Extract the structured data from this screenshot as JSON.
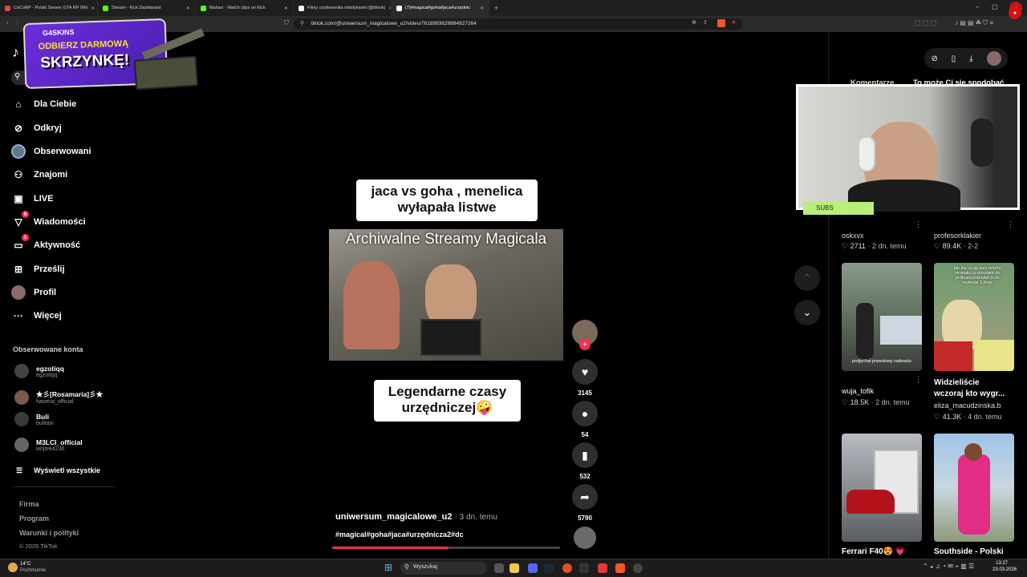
{
  "browser": {
    "tabs": [
      {
        "label": "CoCoRP - Polski Serwer GTA RP Whi",
        "color": "#e5483d"
      },
      {
        "label": "Stream - Kick Dashboard",
        "color": "#53fc18"
      },
      {
        "label": "Maharr - Watch clips on Kick",
        "color": "#53fc18"
      },
      {
        "label": "Filmy użytkownika mlodykamil (@tiktok)",
        "color": "#ffffff"
      },
      {
        "label": "(7)#magical#goha#jaca#urzędnic",
        "color": "#ffffff",
        "active": true
      }
    ],
    "url": "tiktok.com/@uniwersum_magicalowe_u2/video/7618993629884927264"
  },
  "promo": {
    "brand": "G4SKINS",
    "line1": "ODBIERZ DARMOWĄ",
    "line2": "SKRZYNKĘ!"
  },
  "sidebar": {
    "nav": [
      {
        "label": "Dla Ciebie",
        "icon": "home-icon"
      },
      {
        "label": "Odkryj",
        "icon": "compass-icon"
      },
      {
        "label": "Obserwowani",
        "icon": "following-avatar-icon"
      },
      {
        "label": "Znajomi",
        "icon": "friends-icon"
      },
      {
        "label": "LIVE",
        "icon": "live-icon"
      },
      {
        "label": "Wiadomości",
        "icon": "messages-icon",
        "badge": "6"
      },
      {
        "label": "Aktywność",
        "icon": "activity-icon",
        "badge": "1"
      },
      {
        "label": "Prześlij",
        "icon": "upload-icon"
      },
      {
        "label": "Profil",
        "icon": "profile-icon"
      },
      {
        "label": "Więcej",
        "icon": "more-icon"
      }
    ],
    "followed_heading": "Obserwowane konta",
    "followed": [
      {
        "name": "egzotiqq",
        "handle": "egzotiqq"
      },
      {
        "name": "★彡[Rosamaria]彡★",
        "handle": "hasena_official"
      },
      {
        "name": "Buli",
        "handle": "bulitaxi"
      },
      {
        "name": "M3LCI_official",
        "handle": "wojtek4236"
      }
    ],
    "show_all": "Wyświetl wszystkie",
    "footer": [
      "Firma",
      "Program",
      "Warunki i polityki",
      "© 2026 TikTok"
    ]
  },
  "video": {
    "top_caption": [
      "jaca vs goha , menelica",
      "wyłapała listwe"
    ],
    "clip_title": "Archiwalne Streamy Magicala",
    "bottom_caption": [
      "Legendarne czasy",
      "urzędniczej🤪"
    ],
    "author": "uniwersum_magicalowe_u2",
    "posted": "· 3 dn. temu",
    "hashtags": "#magical#goha#jaca#urzędnicza2#dc",
    "progress": 0.51
  },
  "actions": {
    "likes": "3145",
    "comments": "54",
    "saves": "532",
    "shares": "5790"
  },
  "right_panel": {
    "tabs": [
      "Komentarze",
      "To może Ci się spodobać"
    ],
    "webcam_label": "SUBS",
    "row1": [
      {
        "author": "oskxvx",
        "stat": "2711",
        "age": "· 2 dn. temu"
      },
      {
        "author": "profesorklakier",
        "stat": "89.4K",
        "age": "· 2-2"
      }
    ],
    "row2": [
      {
        "title": "",
        "author": "wuja_tofik",
        "stat": "18.5K",
        "age": "· 2 dn. temu",
        "overlay": "podjechał prawdziwy radiowóz"
      },
      {
        "title_lines": [
          "Widzieliście",
          "wczoraj kto wygr..."
        ],
        "author": "eliza_macudzinska.b",
        "stat": "41.3K",
        "age": "· 4 dn. temu",
        "overlay": "jak się czuję jezy mormi hiropaku jo doszlam do pollinalu impostor a on wylecial 1 dnia"
      }
    ],
    "row3": [
      {
        "title": "Ferrari F40😍 💗"
      },
      {
        "title": "Southside - Polski"
      }
    ]
  },
  "taskbar": {
    "weather_temp": "14°C",
    "weather_desc": "Pochmurnie",
    "search": "Wyszukaj",
    "time": "13:27",
    "date": "23.03.2026"
  }
}
